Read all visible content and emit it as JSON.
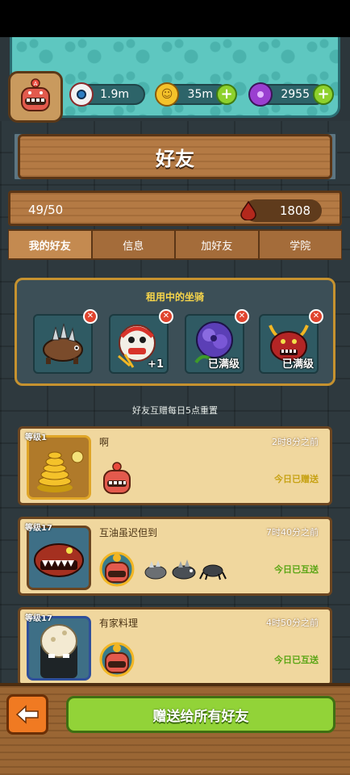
{
  "resources": {
    "eye": {
      "value": "1.9m",
      "icon": "eyeball-icon"
    },
    "coin": {
      "value": "35m",
      "icon": "coin-icon"
    },
    "potion": {
      "value": "2955",
      "icon": "potion-icon"
    }
  },
  "title": "好友",
  "stats": {
    "friend_count": "49/50",
    "blood": "1808"
  },
  "tabs": [
    {
      "label": "我的好友",
      "active": true
    },
    {
      "label": "信息",
      "active": false
    },
    {
      "label": "加好友",
      "active": false
    },
    {
      "label": "学院",
      "active": false
    }
  ],
  "rental": {
    "title": "租用中的坐骑",
    "slots": [
      {
        "label": "",
        "icon": "spiked-beast-mount-icon"
      },
      {
        "label": "+1",
        "icon": "lion-dance-mount-icon"
      },
      {
        "label": "已满级",
        "icon": "purple-flower-mount-icon"
      },
      {
        "label": "已满级",
        "icon": "red-horned-demon-mount-icon"
      }
    ]
  },
  "reset_note": "好友互赠每日5点重置",
  "friends": [
    {
      "level": "等级1",
      "name": "啊",
      "time": "2时8分之前",
      "sent": "今日已赠送",
      "avatar": "gold-coin-pile-icon"
    },
    {
      "level": "等级17",
      "name": "互油虽迟但到",
      "time": "7时40分之前",
      "sent": "今日已互送",
      "avatar": "red-monster-mount-icon"
    },
    {
      "level": "等级17",
      "name": "有家料理",
      "time": "4时50分之前",
      "sent": "今日已互送",
      "avatar": "egg-head-character-icon"
    }
  ],
  "bottom": {
    "gift_all": "赠送给所有好友"
  },
  "colors": {
    "accent_green": "#92d338",
    "wood": "#b47a44",
    "teal": "#5ec7c0",
    "gold": "#f7d54a"
  }
}
